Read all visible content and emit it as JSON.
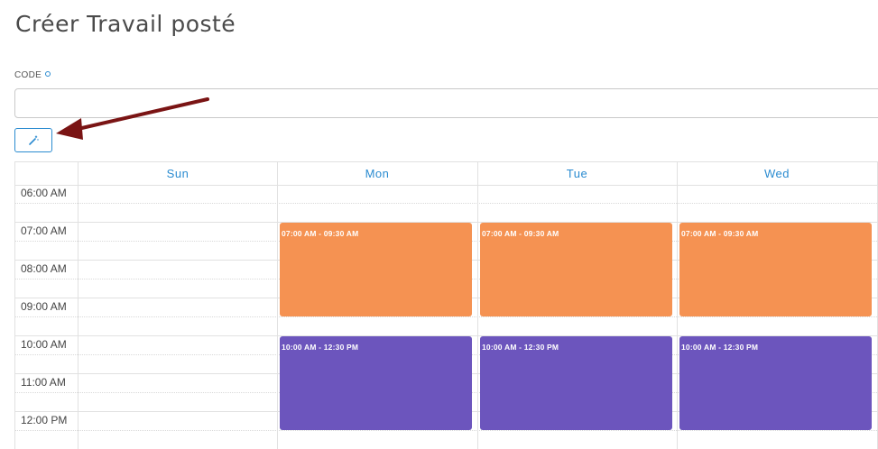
{
  "page": {
    "title": "Créer Travail posté"
  },
  "form": {
    "code_label": "CODE",
    "code_value": "",
    "code_placeholder": ""
  },
  "toolbar": {
    "wand_icon": "magic-wand-icon"
  },
  "calendar": {
    "days": [
      "Sun",
      "Mon",
      "Tue",
      "Wed"
    ],
    "times": [
      "06:00 AM",
      "07:00 AM",
      "08:00 AM",
      "09:00 AM",
      "10:00 AM",
      "11:00 AM",
      "12:00 PM"
    ],
    "events": [
      {
        "day": "Mon",
        "label": "07:00 AM - 09:30 AM",
        "color": "#f59252"
      },
      {
        "day": "Tue",
        "label": "07:00 AM - 09:30 AM",
        "color": "#f59252"
      },
      {
        "day": "Wed",
        "label": "07:00 AM - 09:30 AM",
        "color": "#f59252"
      },
      {
        "day": "Mon",
        "label": "10:00 AM - 12:30 PM",
        "color": "#6c55bd"
      },
      {
        "day": "Tue",
        "label": "10:00 AM - 12:30 PM",
        "color": "#6c55bd"
      },
      {
        "day": "Wed",
        "label": "10:00 AM - 12:30 PM",
        "color": "#6c55bd"
      }
    ]
  },
  "colors": {
    "accent": "#2a8bd0",
    "annotation_arrow": "#7a1414"
  }
}
